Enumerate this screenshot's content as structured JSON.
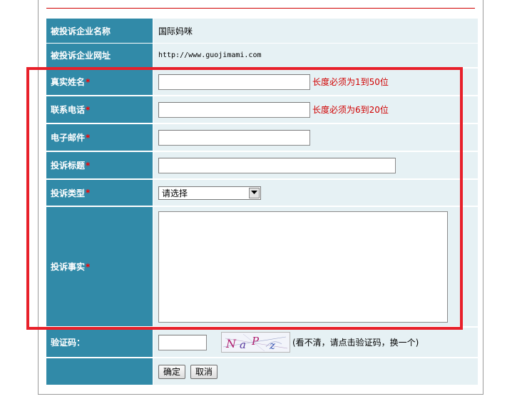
{
  "rows": {
    "company_name": {
      "label": "被投诉企业名称",
      "value": "国际妈咪"
    },
    "company_url": {
      "label": "被投诉企业网址",
      "value": "http://www.guojimami.com"
    },
    "real_name": {
      "label": "真实姓名",
      "required_mark": "*",
      "value": "",
      "hint": "长度必须为1到50位"
    },
    "phone": {
      "label": "联系电话",
      "required_mark": "*",
      "value": "",
      "hint": "长度必须为6到20位"
    },
    "email": {
      "label": "电子邮件",
      "required_mark": "*",
      "value": ""
    },
    "title": {
      "label": "投诉标题",
      "required_mark": "*",
      "value": ""
    },
    "type": {
      "label": "投诉类型",
      "required_mark": "*",
      "selected": "请选择"
    },
    "facts": {
      "label": "投诉事实",
      "required_mark": "*",
      "value": ""
    },
    "captcha": {
      "label": "验证码：",
      "value": "",
      "image_text": "NaPz",
      "note": "(看不清，请点击验证码，换一个)"
    }
  },
  "buttons": {
    "confirm": "确定",
    "cancel": "取消"
  },
  "colors": {
    "label_bg": "#318aa8",
    "value_bg": "#e6f1f4",
    "highlight": "#e8202a",
    "hint": "#d00000"
  }
}
